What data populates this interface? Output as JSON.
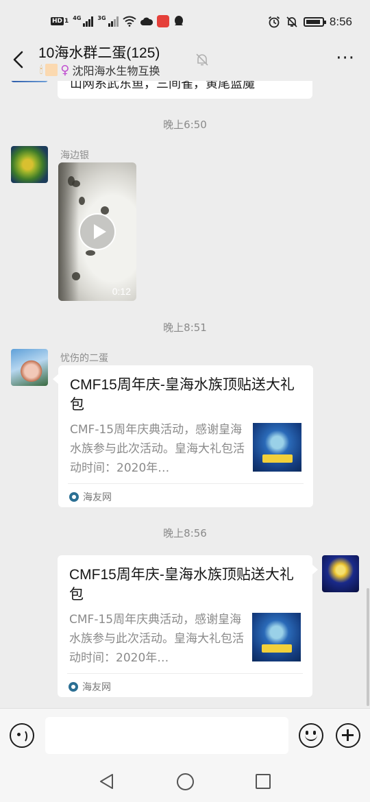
{
  "status_bar": {
    "network_hd": "HD",
    "network_hd_sim": "1",
    "network_4g": "4G",
    "network_3g": "3G",
    "time": "8:56",
    "icons": [
      "hd-icon",
      "signal-4g-icon",
      "signal-3g-icon",
      "wifi-icon",
      "cloud-icon",
      "app-notification-icon",
      "qq-icon",
      "alarm-icon",
      "mute-bell-icon",
      "battery-icon"
    ]
  },
  "header": {
    "title": "10海水群二蛋(125)",
    "subtitle": "沈阳海水生物互换",
    "more_label": "···",
    "icons": [
      "back-arrow-icon",
      "mute-icon",
      "more-icon"
    ]
  },
  "messages": {
    "partial_previous": "山网系武东鱼，三间雀，黄尾蓝魔",
    "time1": "晚上6:50",
    "msg1": {
      "sender": "海边银",
      "type": "video",
      "duration": "0:12"
    },
    "time2": "晚上8:51",
    "msg2": {
      "sender": "忧伤的二蛋",
      "type": "link-card",
      "title": "CMF15周年庆-皇海水族顶贴送大礼包",
      "description": "CMF-15周年庆典活动，感谢皇海水族参与此次活动。皇海大礼包活动时间：2020年…",
      "source": "海友网"
    },
    "time3": "晚上8:56",
    "msg3": {
      "sender": "me",
      "type": "link-card",
      "title": "CMF15周年庆-皇海水族顶贴送大礼包",
      "description": "CMF-15周年庆典活动，感谢皇海水族参与此次活动。皇海大礼包活动时间：2020年…",
      "source": "海友网"
    }
  },
  "input_bar": {
    "text_value": "",
    "icons": [
      "voice-icon",
      "emoji-icon",
      "plus-icon"
    ]
  },
  "nav_bar": {
    "icons": [
      "nav-back-icon",
      "nav-home-icon",
      "nav-recents-icon"
    ]
  },
  "colors": {
    "background": "#ededed",
    "bubble": "#ffffff",
    "timestamp": "#8a8a8a"
  }
}
